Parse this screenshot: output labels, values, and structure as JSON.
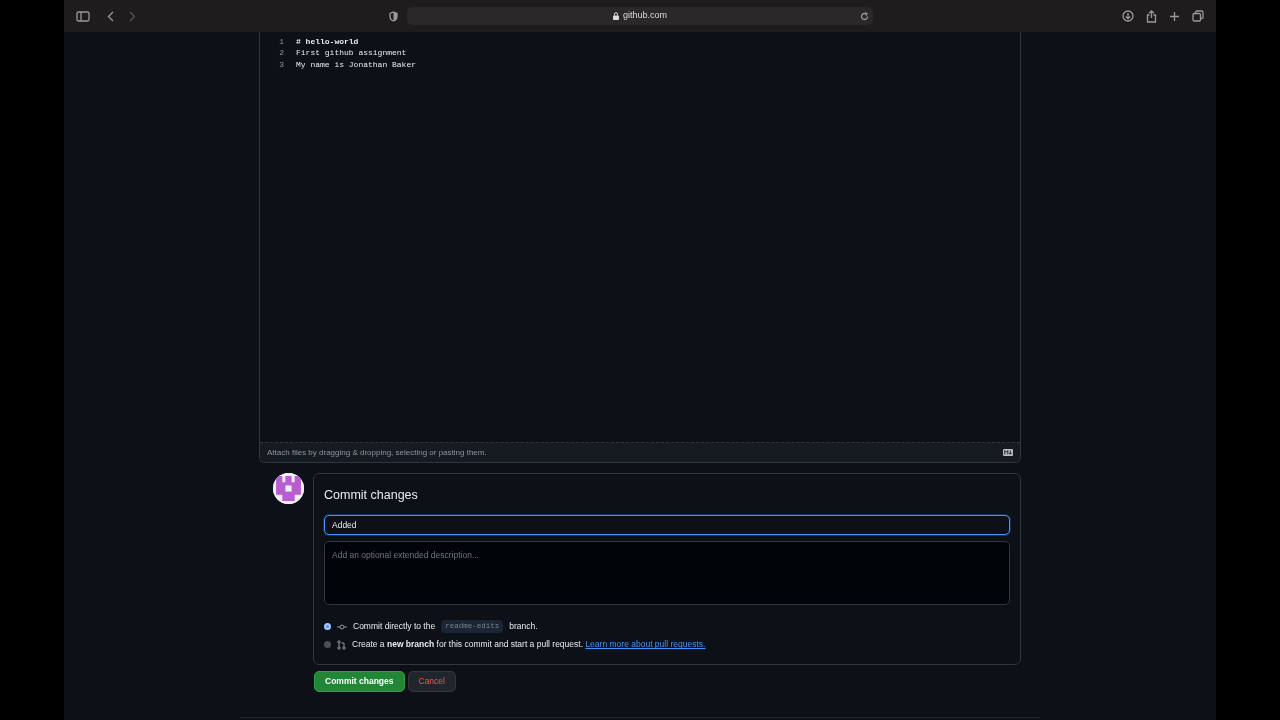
{
  "browser": {
    "url": "github.com"
  },
  "editor": {
    "lines": [
      {
        "number": "1",
        "text": "# hello-world",
        "kind": "heading"
      },
      {
        "number": "2",
        "text": "First github assignment",
        "kind": "plain"
      },
      {
        "number": "3",
        "text": "My name is Jonathan Baker",
        "kind": "plain"
      }
    ],
    "attach_hint": "Attach files by dragging & dropping, selecting or pasting them."
  },
  "commit": {
    "title": "Commit changes",
    "summary": {
      "value": "Added "
    },
    "description": {
      "placeholder": "Add an optional extended description..."
    },
    "options": [
      {
        "kind": "direct",
        "text": "Commit directly to the",
        "branch": "readme-edits",
        "text_after": "branch.",
        "selected": true
      },
      {
        "kind": "new-branch",
        "text": "Create a **new branch** for this commit and start a pull request.",
        "link": "Learn more about pull requests.",
        "selected": false
      }
    ],
    "buttons": [
      {
        "kind": "primary",
        "label": "Commit changes"
      },
      {
        "kind": "cancel",
        "label": "Cancel"
      }
    ]
  }
}
